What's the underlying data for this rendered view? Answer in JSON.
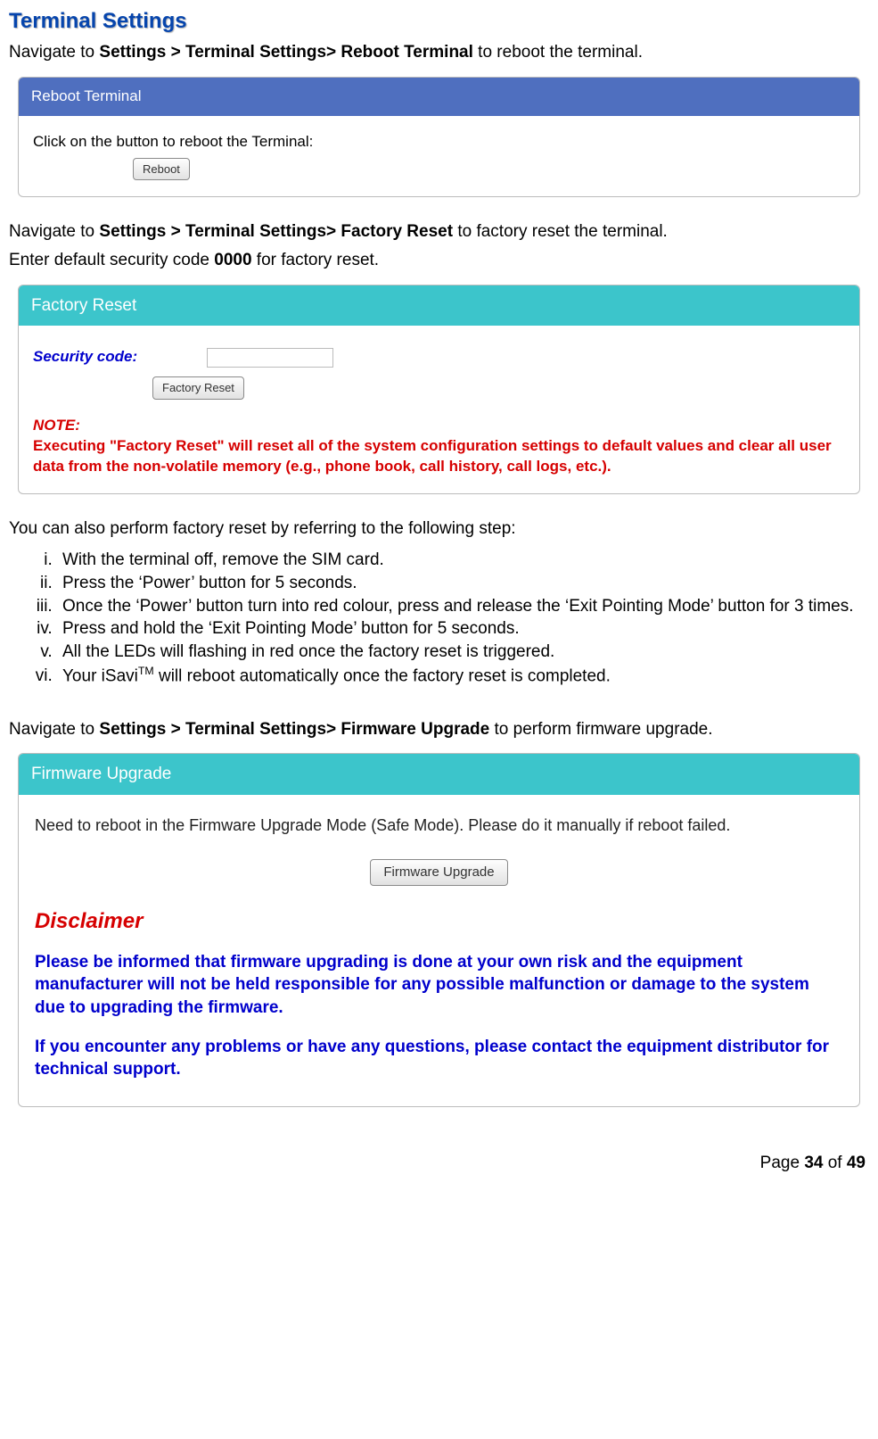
{
  "title": "Terminal Settings",
  "reboot": {
    "nav_prefix": "Navigate to ",
    "nav_bold": "Settings > Terminal Settings> Reboot Terminal",
    "nav_suffix": " to reboot the terminal.",
    "panel_title": "Reboot Terminal",
    "instruction": "Click on the button to reboot the Terminal:",
    "button": "Reboot"
  },
  "factory": {
    "nav_prefix": "Navigate to ",
    "nav_bold": "Settings > Terminal Settings> Factory Reset",
    "nav_suffix": " to factory reset the terminal.",
    "code_line_prefix": "Enter default security code ",
    "code_value": "0000",
    "code_line_suffix": " for factory reset.",
    "panel_title": "Factory Reset",
    "sec_label": "Security code:",
    "button": "Factory Reset",
    "note_title": "NOTE:",
    "note_body": "Executing \"Factory Reset\" will reset all of the system configuration settings to default values and clear all user data from the non-volatile memory (e.g., phone book, call history, call logs, etc.).",
    "alt_intro": "You can also perform factory reset by referring to the following step:",
    "steps": [
      "With the terminal off, remove the SIM card.",
      "Press the ‘Power’ button for 5 seconds.",
      "Once the ‘Power’ button turn into red colour, press and release the ‘Exit Pointing Mode’ button for 3 times.",
      "Press and hold the ‘Exit Pointing Mode’ button for 5 seconds.",
      "All the LEDs will flashing in red once the factory reset is triggered."
    ],
    "step6_pre": "Your iSavi",
    "step6_sup": "TM",
    "step6_post": " will reboot automatically once the factory reset is completed."
  },
  "firmware": {
    "nav_prefix": "Navigate to ",
    "nav_bold": "Settings > Terminal Settings> Firmware Upgrade",
    "nav_suffix": " to perform firmware upgrade.",
    "panel_title": "Firmware Upgrade",
    "message": "Need to reboot in the Firmware Upgrade Mode (Safe Mode). Please do it manually if reboot failed.",
    "button": "Firmware Upgrade",
    "disclaimer_h": "Disclaimer",
    "disclaimer_p1": "Please be informed that firmware upgrading is done at your own risk and the equipment manufacturer will not be held responsible for any possible malfunction or damage to the system due to upgrading the firmware.",
    "disclaimer_p2": "If you encounter any problems or have any questions, please contact the equipment distributor for technical support."
  },
  "footer": {
    "prefix": "Page ",
    "current": "34",
    "mid": " of ",
    "total": "49"
  }
}
